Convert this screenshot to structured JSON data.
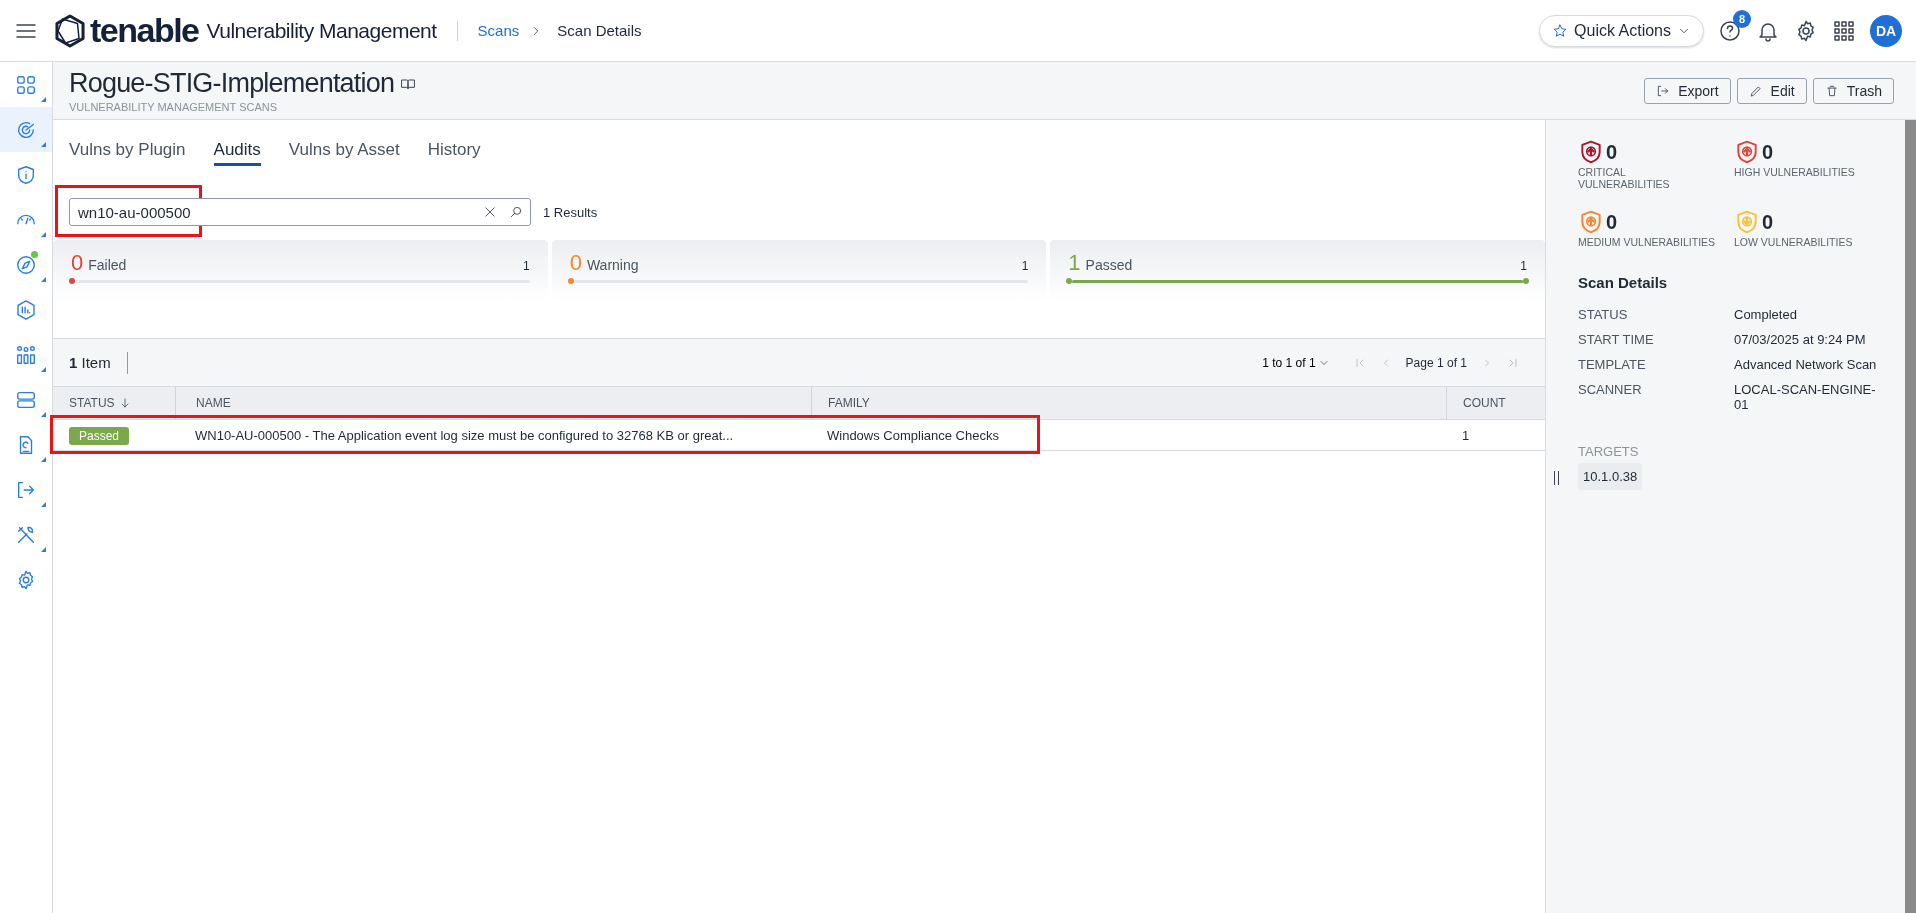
{
  "header": {
    "product": "Vulnerability Management",
    "logo_text": "tenable",
    "breadcrumb": [
      {
        "label": "Scans",
        "link": true
      },
      {
        "label": "Scan Details",
        "link": false
      }
    ],
    "quick_actions": "Quick Actions",
    "help_badge": "8",
    "avatar": "DA"
  },
  "sidebar": {
    "items": [
      {
        "selected": false,
        "submenu": true,
        "dot": false
      },
      {
        "selected": true,
        "submenu": true,
        "dot": false
      },
      {
        "selected": false,
        "submenu": false,
        "dot": false
      },
      {
        "selected": false,
        "submenu": true,
        "dot": false
      },
      {
        "selected": false,
        "submenu": true,
        "dot": true
      },
      {
        "selected": false,
        "submenu": false,
        "dot": false
      },
      {
        "selected": false,
        "submenu": true,
        "dot": false
      },
      {
        "selected": false,
        "submenu": true,
        "dot": false
      },
      {
        "selected": false,
        "submenu": true,
        "dot": false
      },
      {
        "selected": false,
        "submenu": true,
        "dot": false
      },
      {
        "selected": false,
        "submenu": true,
        "dot": false
      },
      {
        "selected": false,
        "submenu": false,
        "dot": false
      }
    ]
  },
  "page": {
    "title": "Rogue-STIG-Implementation",
    "subtitle": "VULNERABILITY MANAGEMENT SCANS",
    "actions": [
      {
        "kind": "export",
        "label": "Export"
      },
      {
        "kind": "edit",
        "label": "Edit"
      },
      {
        "kind": "trash",
        "label": "Trash"
      }
    ]
  },
  "tabs": [
    {
      "label": "Vulns by Plugin",
      "selected": false
    },
    {
      "label": "Audits",
      "selected": true
    },
    {
      "label": "Vulns by Asset",
      "selected": false
    },
    {
      "label": "History",
      "selected": false
    }
  ],
  "search": {
    "value": "wn10-au-000500",
    "highlighted": true,
    "results": "1 Results"
  },
  "summary": [
    {
      "count": "0",
      "label": "Failed",
      "total": "1",
      "level": 0,
      "color": "#e0443e"
    },
    {
      "count": "0",
      "label": "Warning",
      "total": "1",
      "level": 0,
      "color": "#f08a30"
    },
    {
      "count": "1",
      "label": "Passed",
      "total": "1",
      "level": 1,
      "color": "#7aa84a"
    }
  ],
  "toolbar": {
    "count": "1",
    "count_label": "Item",
    "range": "1 to 1 of 1",
    "page": "Page 1 of 1"
  },
  "table": {
    "columns": [
      {
        "label": "STATUS",
        "sorted": true
      },
      {
        "label": "NAME",
        "sorted": false
      },
      {
        "label": "FAMILY",
        "sorted": false
      },
      {
        "label": "COUNT",
        "sorted": false
      }
    ],
    "rows": [
      {
        "status": "Passed",
        "name": "WN10-AU-000500 - The Application event log size must be configured to 32768 KB or great...",
        "family": "Windows Compliance Checks",
        "count": "1",
        "highlighted": true
      }
    ]
  },
  "severity": [
    {
      "count": "0",
      "label": "CRITICAL VULNERABILITIES",
      "color": "#a3192f",
      "kind": "up"
    },
    {
      "count": "0",
      "label": "HIGH VULNERABILITIES",
      "color": "#e0443e",
      "kind": "up"
    },
    {
      "count": "0",
      "label": "MEDIUM VULNERABILITIES",
      "color": "#f08a30",
      "kind": "up"
    },
    {
      "count": "0",
      "label": "LOW VULNERABILITIES",
      "color": "#f5c33b",
      "kind": "down"
    }
  ],
  "scan_details": {
    "title": "Scan Details",
    "fields": [
      {
        "label": "STATUS",
        "value": "Completed"
      },
      {
        "label": "START TIME",
        "value": "07/03/2025 at 9:24 PM"
      },
      {
        "label": "TEMPLATE",
        "value": "Advanced Network Scan"
      },
      {
        "label": "SCANNER",
        "value": "LOCAL-SCAN-ENGINE-01"
      }
    ],
    "targets_label": "TARGETS",
    "targets": [
      "10.1.0.38"
    ]
  }
}
